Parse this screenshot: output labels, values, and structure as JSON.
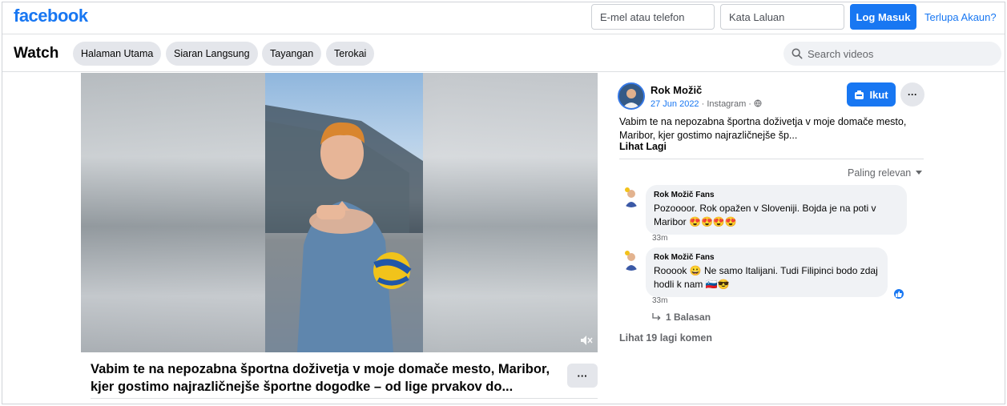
{
  "brand": {
    "logo_text": "facebook",
    "color": "#1877f2"
  },
  "login": {
    "email_placeholder": "E-mel atau telefon",
    "password_placeholder": "Kata Laluan",
    "login_button": "Log Masuk",
    "forgot_link": "Terlupa Akaun?"
  },
  "watch_nav": {
    "title": "Watch",
    "tabs": [
      {
        "label": "Halaman Utama"
      },
      {
        "label": "Siaran Langsung"
      },
      {
        "label": "Tayangan"
      },
      {
        "label": "Terokai"
      }
    ],
    "search_placeholder": "Search videos"
  },
  "video": {
    "title": "Vabim te na nepozabna športna doživetja v moje domače mesto, Maribor, kjer gostimo najrazličnejše športne dogodke – od lige prvakov do...",
    "more_label": "···",
    "mute_icon": "speaker-muted-icon"
  },
  "post": {
    "author": "Rok Možič",
    "date": "27 Jun 2022",
    "source": " · Instagram · ",
    "privacy_icon": "globe-icon",
    "follow_button": "Ikut",
    "more_label": "···",
    "text": "Vabim te na nepozabna športna doživetja v moje domače mesto, Maribor, kjer gostimo najrazličnejše šp...",
    "see_more": "Lihat Lagi"
  },
  "comments": {
    "sort_label": "Paling relevan",
    "items": [
      {
        "author": "Rok Možič Fans",
        "text": "Pozoooor. Rok opažen v Sloveniji. Bojda je na poti v Maribor 😍😍😍😍",
        "time": "33m"
      },
      {
        "author": "Rok Možič Fans",
        "text": "Rooook 😀 Ne samo Italijani. Tudi Filipinci bodo zdaj hodli k nam 🇸🇮😎",
        "time": "33m",
        "reaction": "like"
      }
    ],
    "replies_label": "1 Balasan",
    "view_more": "Lihat 19 lagi komen"
  }
}
